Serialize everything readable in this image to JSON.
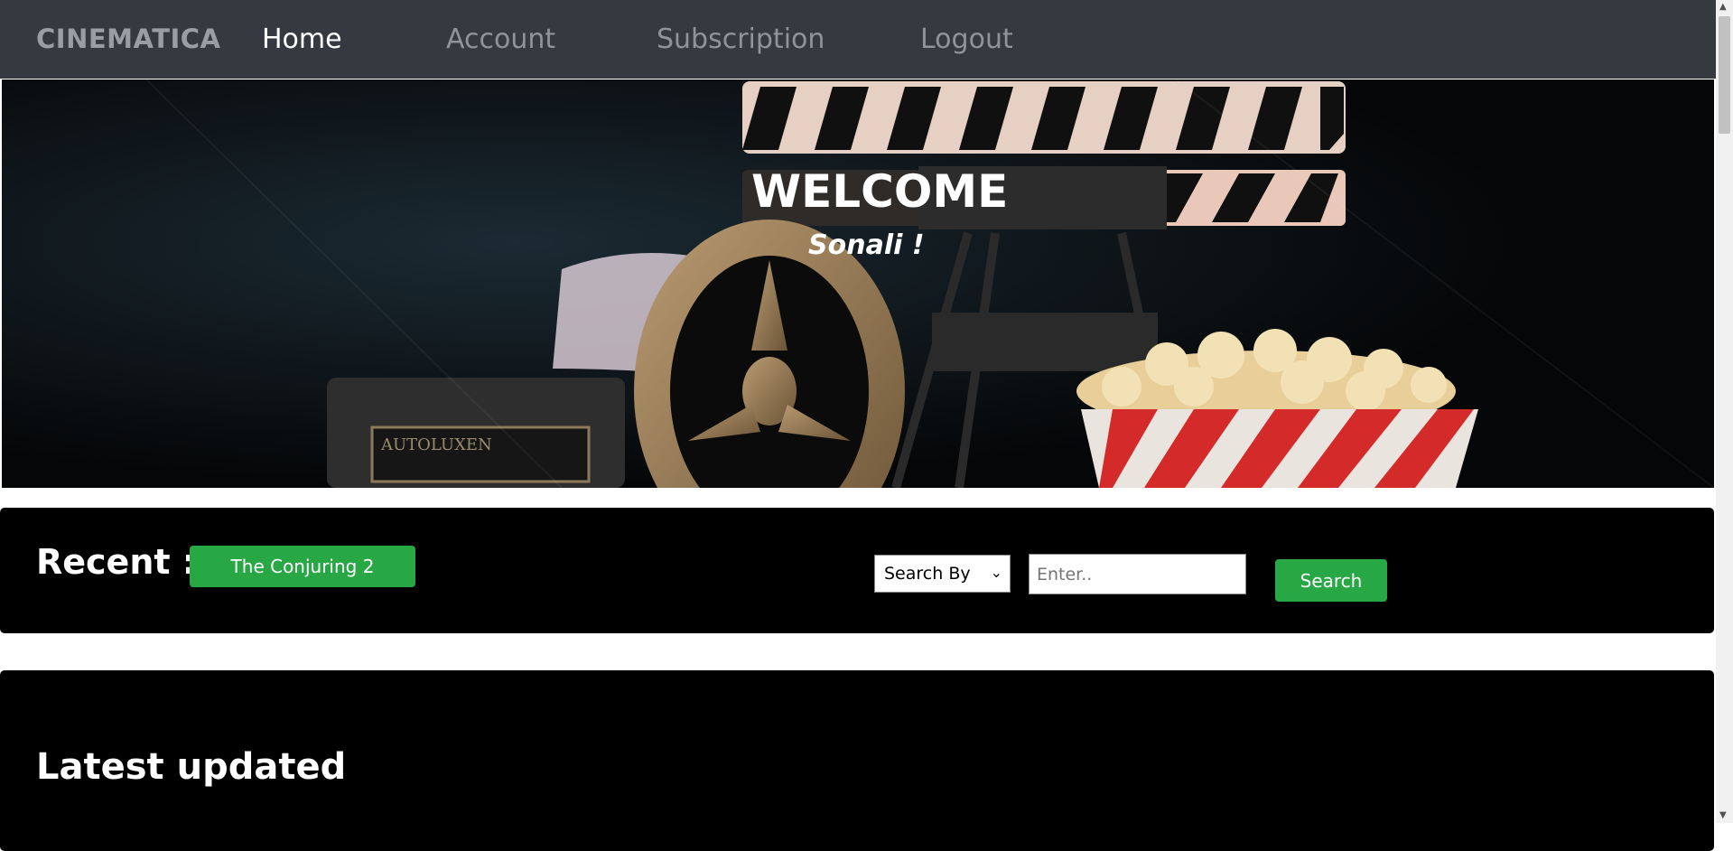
{
  "navbar": {
    "brand": "CINEMATICA",
    "links": [
      {
        "label": "Home",
        "active": true
      },
      {
        "label": "Account",
        "active": false
      },
      {
        "label": "Subscription",
        "active": false
      },
      {
        "label": "Logout",
        "active": false
      }
    ]
  },
  "hero": {
    "welcome": "WELCOME",
    "username": "Sonali !",
    "reel_label": "AUTOLUXEN"
  },
  "recent": {
    "label": "Recent :",
    "movie_button": "The Conjuring 2"
  },
  "search": {
    "select_value": "Search By",
    "input_placeholder": "Enter..",
    "button_label": "Search"
  },
  "latest": {
    "title": "Latest updated"
  },
  "colors": {
    "navbar_bg": "#343a40",
    "accent_green": "#28a745",
    "panel_bg": "#000000"
  }
}
